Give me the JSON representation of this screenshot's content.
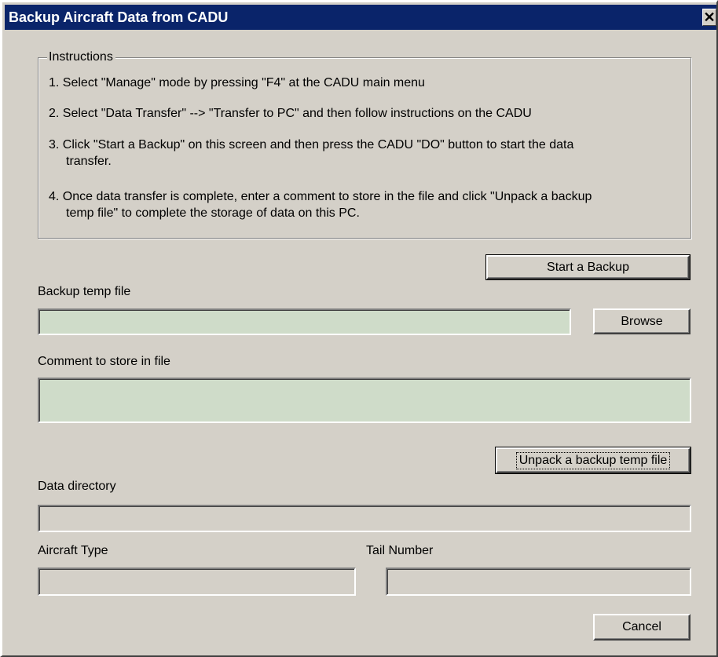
{
  "window": {
    "title": "Backup Aircraft Data from CADU",
    "close_glyph": "✕"
  },
  "instructions": {
    "legend": "Instructions",
    "steps": [
      "1. Select \"Manage\" mode by pressing \"F4\" at the CADU main menu",
      "2. Select \"Data Transfer\" --> \"Transfer to PC\" and then follow instructions on the CADU",
      "3. Click \"Start a Backup\" on this screen and then press the CADU \"DO\" button to start the data",
      "transfer.",
      "4. Once data transfer is complete, enter a comment to store in the file and click \"Unpack a backup",
      "temp file\" to complete the storage of data on this PC."
    ]
  },
  "backup": {
    "start_label": "Start a Backup",
    "temp_file_label": "Backup temp file",
    "temp_file_value": "",
    "browse_label": "Browse",
    "comment_label": "Comment to store in file",
    "comment_value": "",
    "unpack_label": "Unpack a backup temp file"
  },
  "details": {
    "data_dir_label": "Data directory",
    "data_dir_value": "",
    "aircraft_type_label": "Aircraft Type",
    "aircraft_type_value": "",
    "tail_number_label": "Tail Number",
    "tail_number_value": ""
  },
  "footer": {
    "cancel_label": "Cancel"
  },
  "colors": {
    "dialog_face": "#d4d0c8",
    "titlebar": "#0a246a",
    "editable_field": "#cfdcc9"
  },
  "icons": {
    "close": "close-icon"
  }
}
